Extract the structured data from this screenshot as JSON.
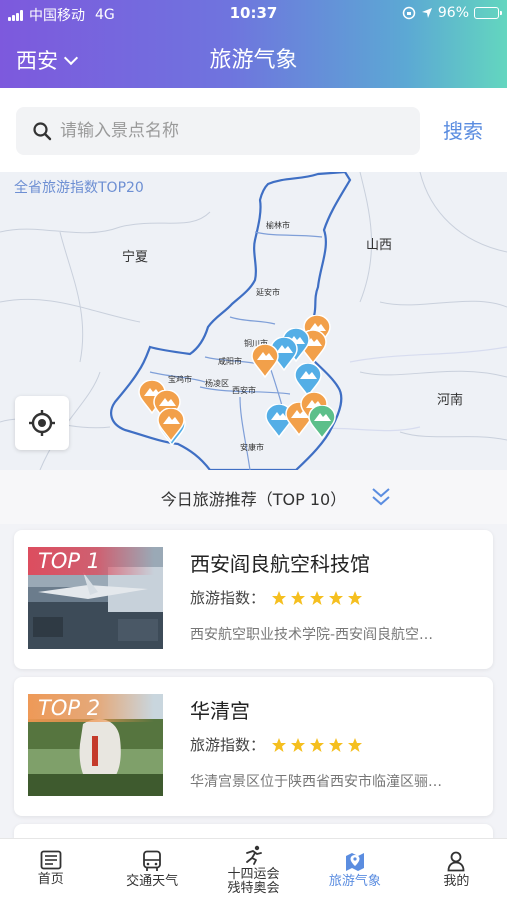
{
  "status_bar": {
    "carrier": "中国移动",
    "network": "4G",
    "time": "10:37",
    "battery": "96%"
  },
  "header": {
    "city": "西安",
    "title": "旅游气象"
  },
  "search": {
    "placeholder": "请输入景点名称",
    "button": "搜索"
  },
  "map": {
    "title": "全省旅游指数TOP20",
    "labels": {
      "ningxia": "宁夏",
      "shanxi": "山西",
      "henan": "河南"
    },
    "cities": {
      "yulin": "榆林市",
      "yanan": "延安市",
      "tongchuan": "铜川市",
      "xianyang": "咸阳市",
      "baoji": "宝鸡市",
      "yangling": "杨凌区",
      "xian": "西安市",
      "ankang": "安康市"
    },
    "pin_colors": {
      "orange": "#f2a04a",
      "blue": "#54aee6",
      "green": "#5cbf8a"
    }
  },
  "recommend": {
    "title": "今日旅游推荐（TOP 10）",
    "items": [
      {
        "rank": "TOP 1",
        "name": "西安阎良航空科技馆",
        "index_label": "旅游指数：",
        "rating": 5,
        "desc": "西安航空职业技术学院-西安阎良航空…"
      },
      {
        "rank": "TOP 2",
        "name": "华清宫",
        "index_label": "旅游指数：",
        "rating": 5,
        "desc": "华清宫景区位于陕西省西安市临潼区骊…"
      }
    ]
  },
  "tabs": [
    {
      "label": "首页",
      "icon": "news-icon"
    },
    {
      "label": "交通天气",
      "icon": "bus-icon"
    },
    {
      "label": "十四运会\n残特奥会",
      "icon": "runner-icon"
    },
    {
      "label": "旅游气象",
      "icon": "map-pin-icon",
      "active": true
    },
    {
      "label": "我的",
      "icon": "person-icon"
    }
  ]
}
